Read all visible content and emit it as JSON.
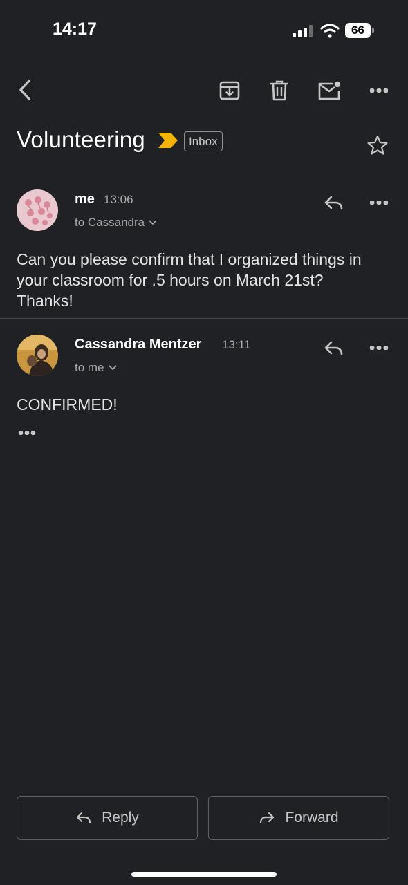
{
  "status_bar": {
    "time": "14:17",
    "battery": "66"
  },
  "header": {
    "subject": "Volunteering",
    "label": "Inbox"
  },
  "messages": [
    {
      "sender": "me",
      "time": "13:06",
      "to": "to Cassandra",
      "body": "Can you please confirm that I organized things in your classroom for .5 hours on March 21st? Thanks!"
    },
    {
      "sender": "Cassandra Mentzer",
      "time": "13:11",
      "to": "to me",
      "body": "CONFIRMED!"
    }
  ],
  "actions": {
    "reply": "Reply",
    "forward": "Forward"
  },
  "colors": {
    "background": "#202124",
    "important_marker": "#f5b400"
  }
}
